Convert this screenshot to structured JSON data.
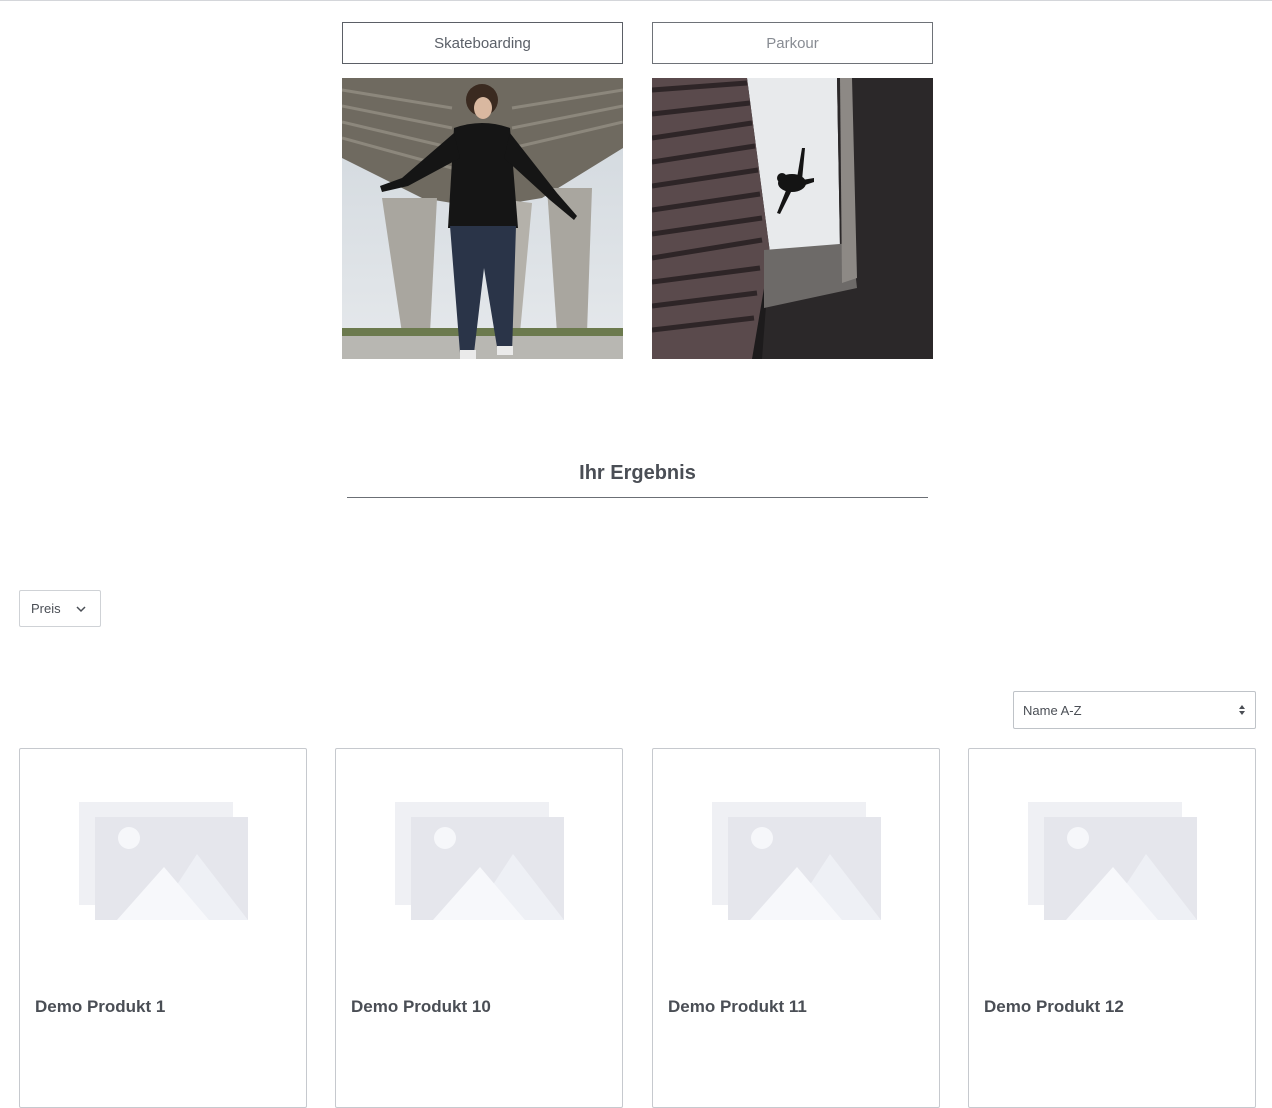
{
  "categories": [
    {
      "label": "Skateboarding",
      "image": "skateboarder-photo"
    },
    {
      "label": "Parkour",
      "image": "parkour-jump-photo"
    }
  ],
  "results": {
    "title": "Ihr Ergebnis"
  },
  "filters": {
    "price_label": "Preis"
  },
  "sorting": {
    "selected": "Name A-Z"
  },
  "products": [
    {
      "name": "Demo Produkt 1"
    },
    {
      "name": "Demo Produkt 10"
    },
    {
      "name": "Demo Produkt 11"
    },
    {
      "name": "Demo Produkt 12"
    }
  ],
  "colors": {
    "text": "#4a4e55",
    "border": "#c6c9ce",
    "placeholder_back": "#eff0f4",
    "placeholder_front": "#e5e6ec"
  }
}
